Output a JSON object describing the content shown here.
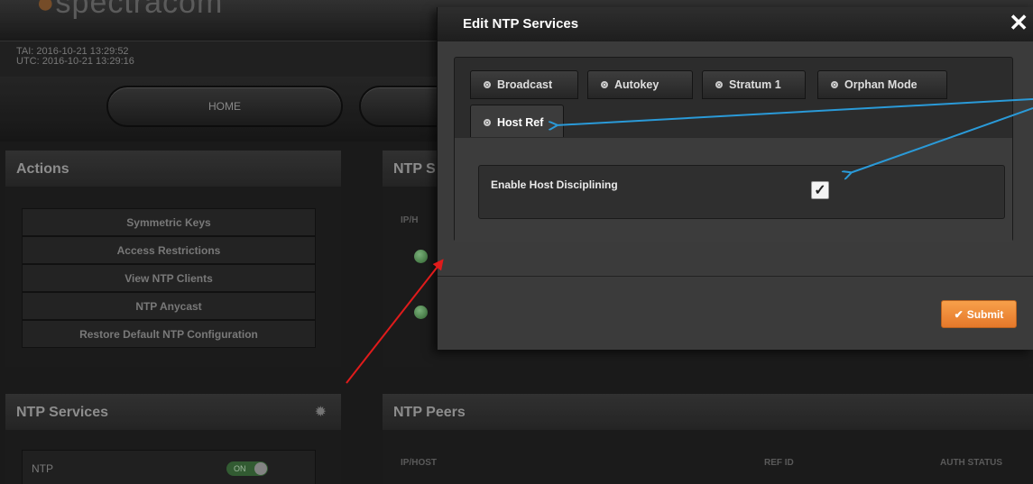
{
  "brand": {
    "logo_text": "spectracom"
  },
  "clock": {
    "tai": "TAI: 2016-10-21 13:29:52",
    "utc": "UTC: 2016-10-21 13:29:16"
  },
  "nav": {
    "home_label": "HOME"
  },
  "actions_panel": {
    "title": "Actions",
    "items": [
      {
        "label": "Symmetric Keys"
      },
      {
        "label": "Access Restrictions"
      },
      {
        "label": "View NTP Clients"
      },
      {
        "label": "NTP Anycast"
      },
      {
        "label": "Restore Default NTP Configuration"
      }
    ]
  },
  "ntp_status_panel": {
    "title": "NTP S",
    "col_iphost": "IP/H"
  },
  "ntp_services_panel": {
    "title": "NTP Services",
    "row_label": "NTP",
    "toggle_label": "ON",
    "gear_icon": "gear-icon"
  },
  "ntp_peers_panel": {
    "title": "NTP Peers",
    "columns": [
      "IP/HOST",
      "REF ID",
      "AUTH STATUS"
    ]
  },
  "modal": {
    "title": "Edit NTP Services",
    "close_glyph": "✕",
    "tabs": [
      {
        "label": "Broadcast"
      },
      {
        "label": "Autokey"
      },
      {
        "label": "Stratum 1"
      },
      {
        "label": "Orphan Mode"
      },
      {
        "label": "Host Ref"
      }
    ],
    "active_tab": "Host Ref",
    "field_label": "Enable Host Disciplining",
    "field_checked": true,
    "checkmark": "✓",
    "submit_label": "Submit",
    "submit_icon": "✔"
  },
  "colors": {
    "accent_orange": "#f0883a",
    "arrow_blue": "#2a9ad8",
    "arrow_red": "#e01b1b"
  }
}
